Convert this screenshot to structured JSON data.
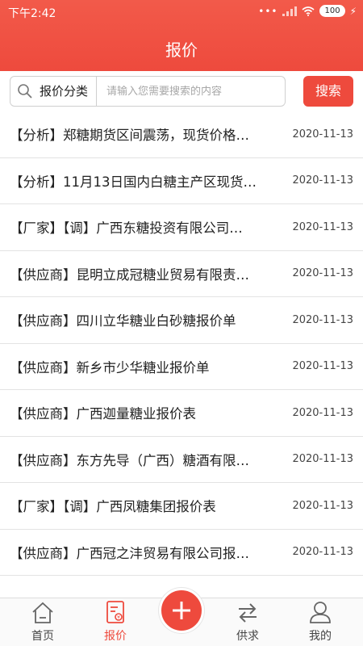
{
  "status": {
    "time": "下午2:42",
    "battery": "100"
  },
  "header": {
    "title": "报价"
  },
  "search": {
    "category": "报价分类",
    "placeholder": "请输入您需要搜索的内容",
    "button": "搜索"
  },
  "items": [
    {
      "title": "【分析】郑糖期货区间震荡，现货价格…",
      "date": "2020-11-13"
    },
    {
      "title": "【分析】11月13日国内白糖主产区现货…",
      "date": "2020-11-13"
    },
    {
      "title": "【厂家】【调】广西东糖投资有限公司…",
      "date": "2020-11-13"
    },
    {
      "title": "【供应商】昆明立成冠糖业贸易有限责…",
      "date": "2020-11-13"
    },
    {
      "title": "【供应商】四川立华糖业白砂糖报价单",
      "date": "2020-11-13"
    },
    {
      "title": "【供应商】新乡市少华糖业报价单",
      "date": "2020-11-13"
    },
    {
      "title": "【供应商】广西迦量糖业报价表",
      "date": "2020-11-13"
    },
    {
      "title": "【供应商】东方先导（广西）糖酒有限…",
      "date": "2020-11-13"
    },
    {
      "title": "【厂家】【调】广西凤糖集团报价表",
      "date": "2020-11-13"
    },
    {
      "title": "【供应商】广西冠之沣贸易有限公司报…",
      "date": "2020-11-13"
    }
  ],
  "tabs": [
    {
      "label": "首页",
      "icon": "home-icon"
    },
    {
      "label": "报价",
      "icon": "quote-doc-icon",
      "active": true
    },
    {
      "label": "供求",
      "icon": "exchange-arrows-icon"
    },
    {
      "label": "我的",
      "icon": "user-icon"
    }
  ],
  "colors": {
    "accent": "#ee4a3d"
  }
}
